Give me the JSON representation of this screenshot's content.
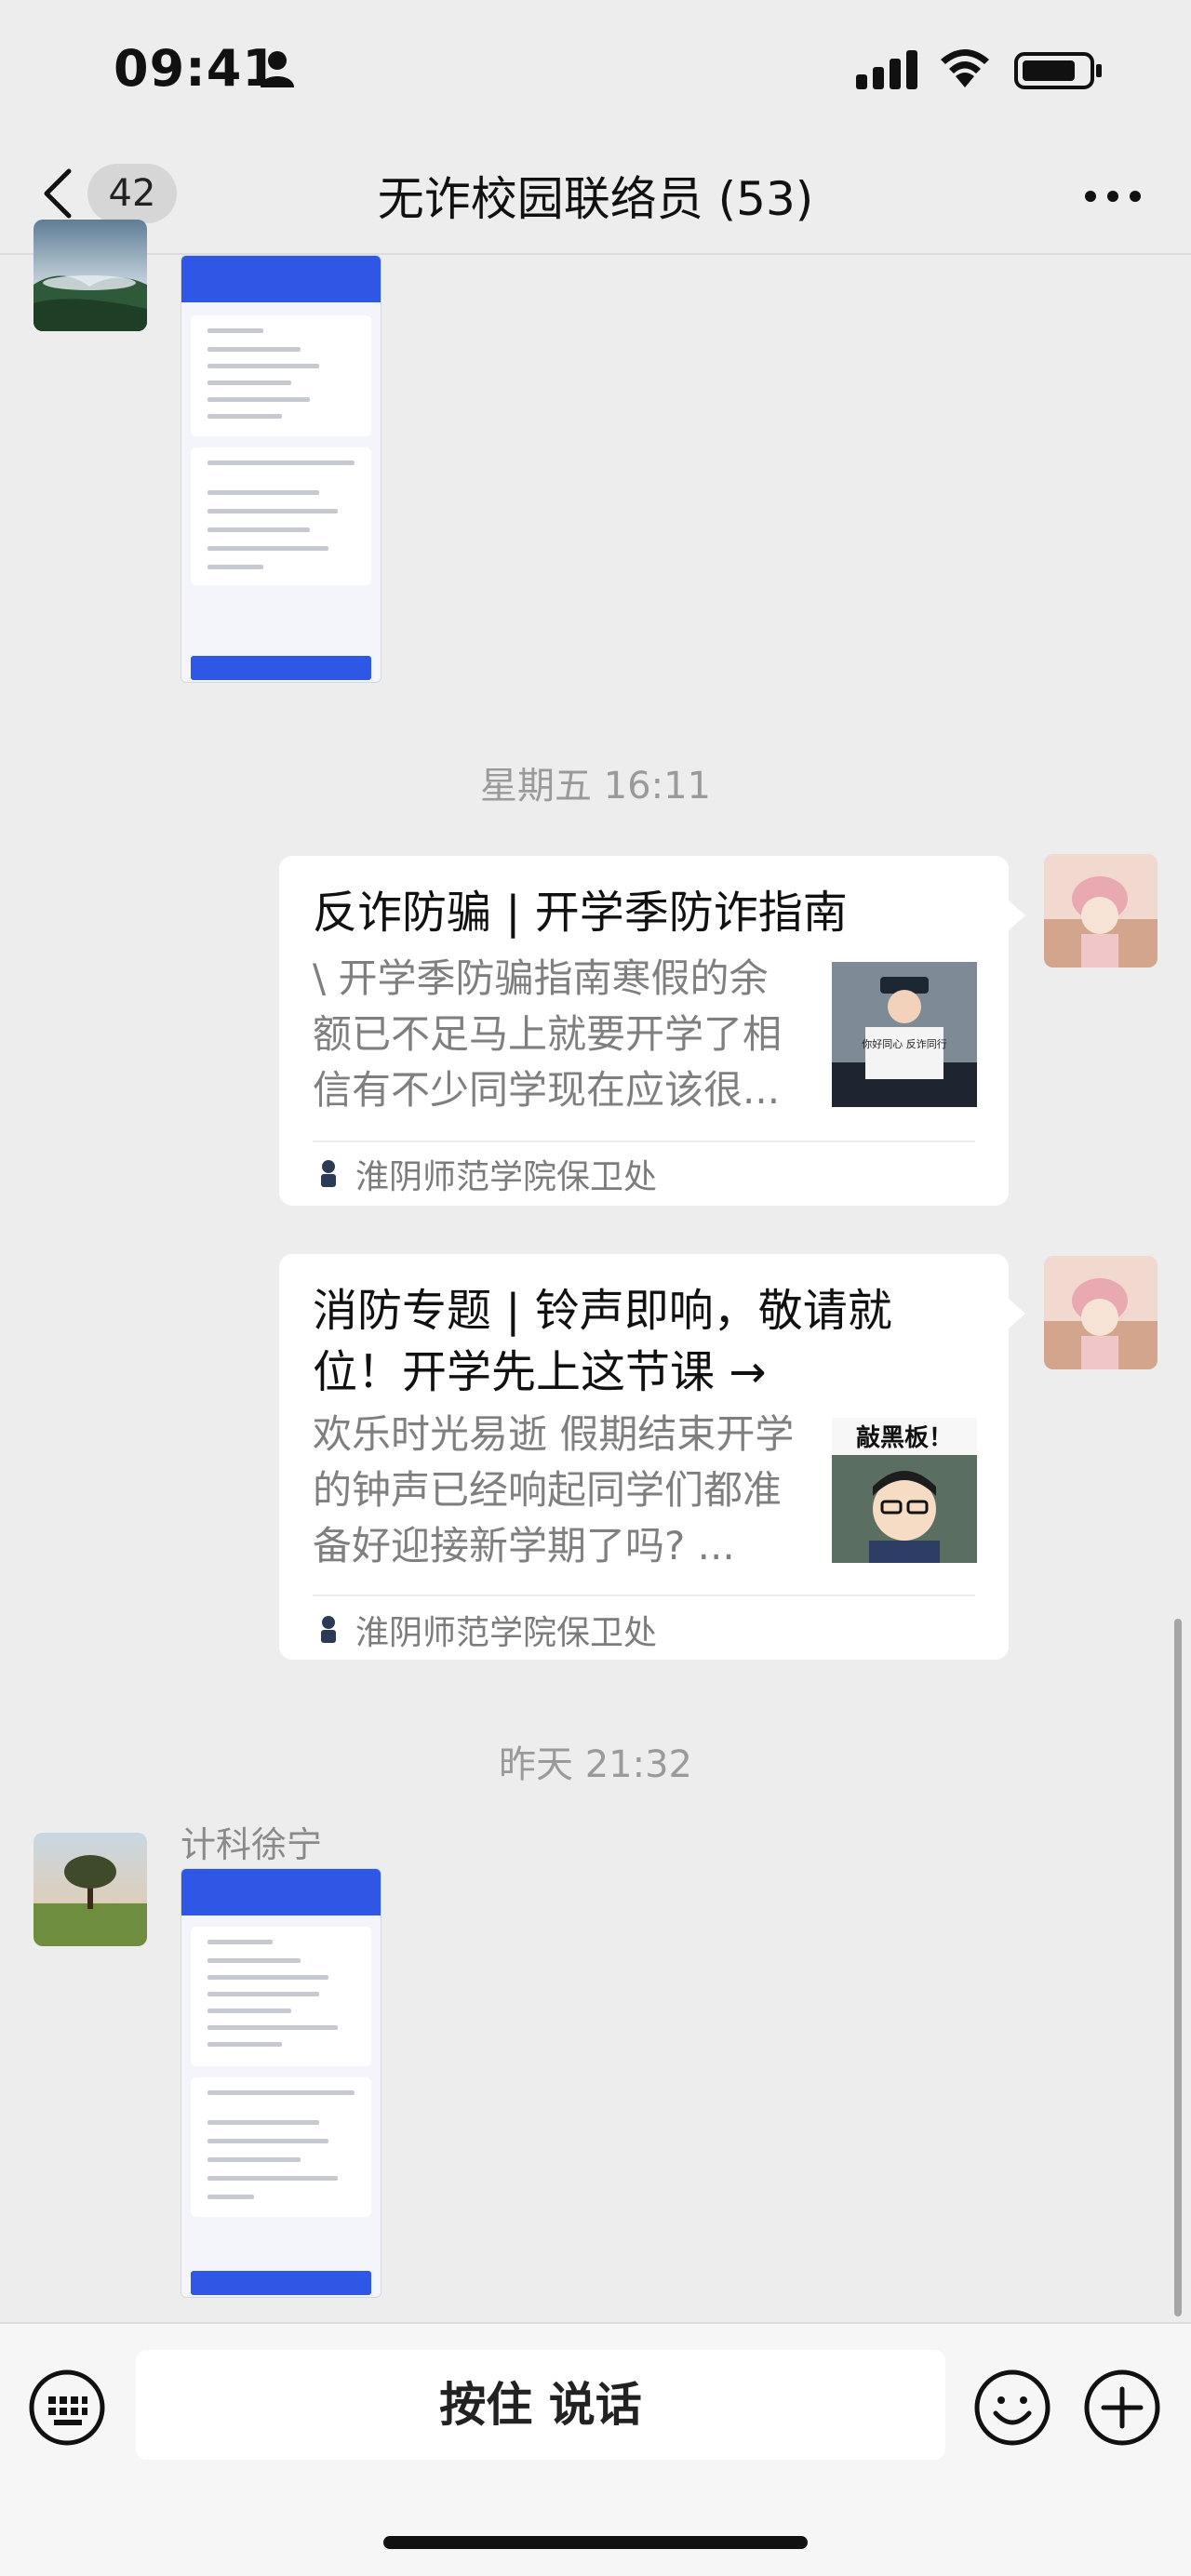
{
  "status_bar": {
    "time": "09:41"
  },
  "nav": {
    "unread_count": "42",
    "title": "无诈校园联络员 (53)"
  },
  "messages": {
    "time_label_1": "星期五 16:11",
    "article_1": {
      "title": "反诈防骗 | 开学季防诈指南",
      "desc": "\\ 开学季防骗指南寒假的余额已不足马上就要开学了相信有不少同学现在应该很...",
      "thumb_text": "你好同心 反诈同行",
      "source": "淮阴师范学院保卫处"
    },
    "article_2": {
      "title": "消防专题 | 铃声即响，敬请就位！开学先上这节课 →",
      "desc": "欢乐时光易逝 假期结束开学的钟声已经响起同学们都准备好迎接新学期了吗? ...",
      "thumb_text": "敲黑板！",
      "source": "淮阴师范学院保卫处"
    },
    "time_label_2": "昨天 21:32",
    "sender_name": "计科徐宁"
  },
  "input_bar": {
    "voice_label": "按住 说话"
  },
  "colors": {
    "background": "#ededed",
    "bubble": "#ffffff",
    "accent_blue": "#2f57e6"
  }
}
